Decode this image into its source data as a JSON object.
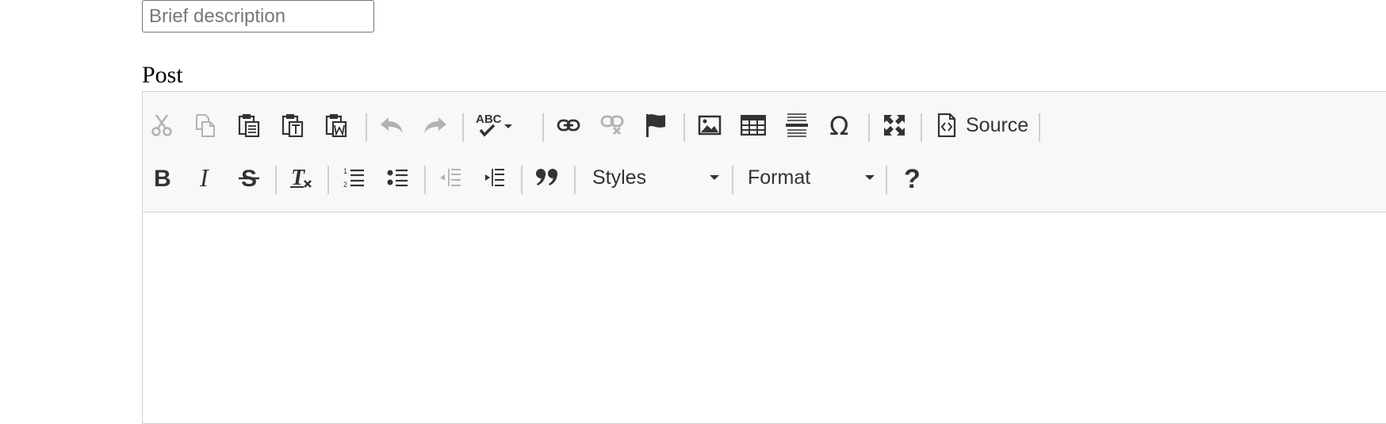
{
  "form": {
    "description_placeholder": "Brief description",
    "description_value": "",
    "post_label": "Post"
  },
  "editor": {
    "toolbar_row1": [
      {
        "name": "cut-button",
        "icon": "scissors-icon",
        "enabled": false
      },
      {
        "name": "copy-button",
        "icon": "copy-icon",
        "enabled": false
      },
      {
        "name": "paste-button",
        "icon": "clipboard-icon",
        "enabled": true
      },
      {
        "name": "paste-text-button",
        "icon": "clipboard-text-icon",
        "enabled": true
      },
      {
        "name": "paste-word-button",
        "icon": "clipboard-word-icon",
        "enabled": true
      },
      {
        "name": "undo-button",
        "icon": "undo-icon",
        "enabled": false
      },
      {
        "name": "redo-button",
        "icon": "redo-icon",
        "enabled": false
      },
      {
        "name": "spellcheck-button",
        "icon": "spellcheck-icon",
        "enabled": true
      },
      {
        "name": "link-button",
        "icon": "link-icon",
        "enabled": true
      },
      {
        "name": "unlink-button",
        "icon": "unlink-icon",
        "enabled": false
      },
      {
        "name": "anchor-button",
        "icon": "flag-icon",
        "enabled": true
      },
      {
        "name": "image-button",
        "icon": "image-icon",
        "enabled": true
      },
      {
        "name": "table-button",
        "icon": "table-icon",
        "enabled": true
      },
      {
        "name": "horizontal-rule-button",
        "icon": "horizontal-rule-icon",
        "enabled": true
      },
      {
        "name": "special-char-button",
        "icon": "omega-icon",
        "enabled": true
      },
      {
        "name": "maximize-button",
        "icon": "maximize-icon",
        "enabled": true
      }
    ],
    "source_label": "Source",
    "styles_label": "Styles",
    "format_label": "Format",
    "spellcheck_text": "ABC",
    "colors": {
      "toolbar_bg": "#f8f8f8",
      "border": "#d1d1d1",
      "icon": "#333333",
      "disabled_icon": "#a8a8a8"
    }
  }
}
